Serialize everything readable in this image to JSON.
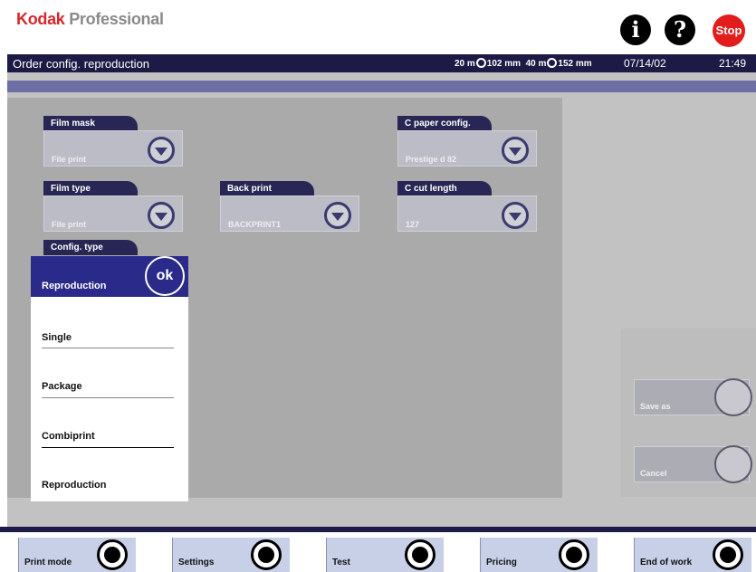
{
  "header": {
    "brand_main": "Kodak",
    "brand_rest": " Professional",
    "info_icon": "i",
    "help_icon": "?",
    "stop_label": "Stop"
  },
  "titlebar": {
    "title": "Order config. reproduction",
    "roll1_length": "20 m",
    "roll1_width": "102 mm",
    "roll2_length": "40 m",
    "roll2_width": "152 mm",
    "date": "07/14/02",
    "time": "21:49"
  },
  "fields": {
    "film_mask": {
      "label": "Film mask",
      "value": "File print"
    },
    "film_type": {
      "label": "Film type",
      "value": "File print"
    },
    "back_print": {
      "label": "Back print",
      "value": "BACKPRINT1"
    },
    "c_paper_config": {
      "label": "C paper config.",
      "value": "Prestige d 82"
    },
    "c_cut_length": {
      "label": "C cut length",
      "value": "127"
    }
  },
  "config_type": {
    "label": "Config. type",
    "current": "Reproduction",
    "ok_label": "ok",
    "options": [
      "Single",
      "Package",
      "Combiprint",
      "Reproduction"
    ]
  },
  "side": {
    "save_as": "Save as",
    "cancel": "Cancel"
  },
  "bottom_nav": [
    "Print mode",
    "Settings",
    "Test",
    "Pricing",
    "End of work"
  ]
}
